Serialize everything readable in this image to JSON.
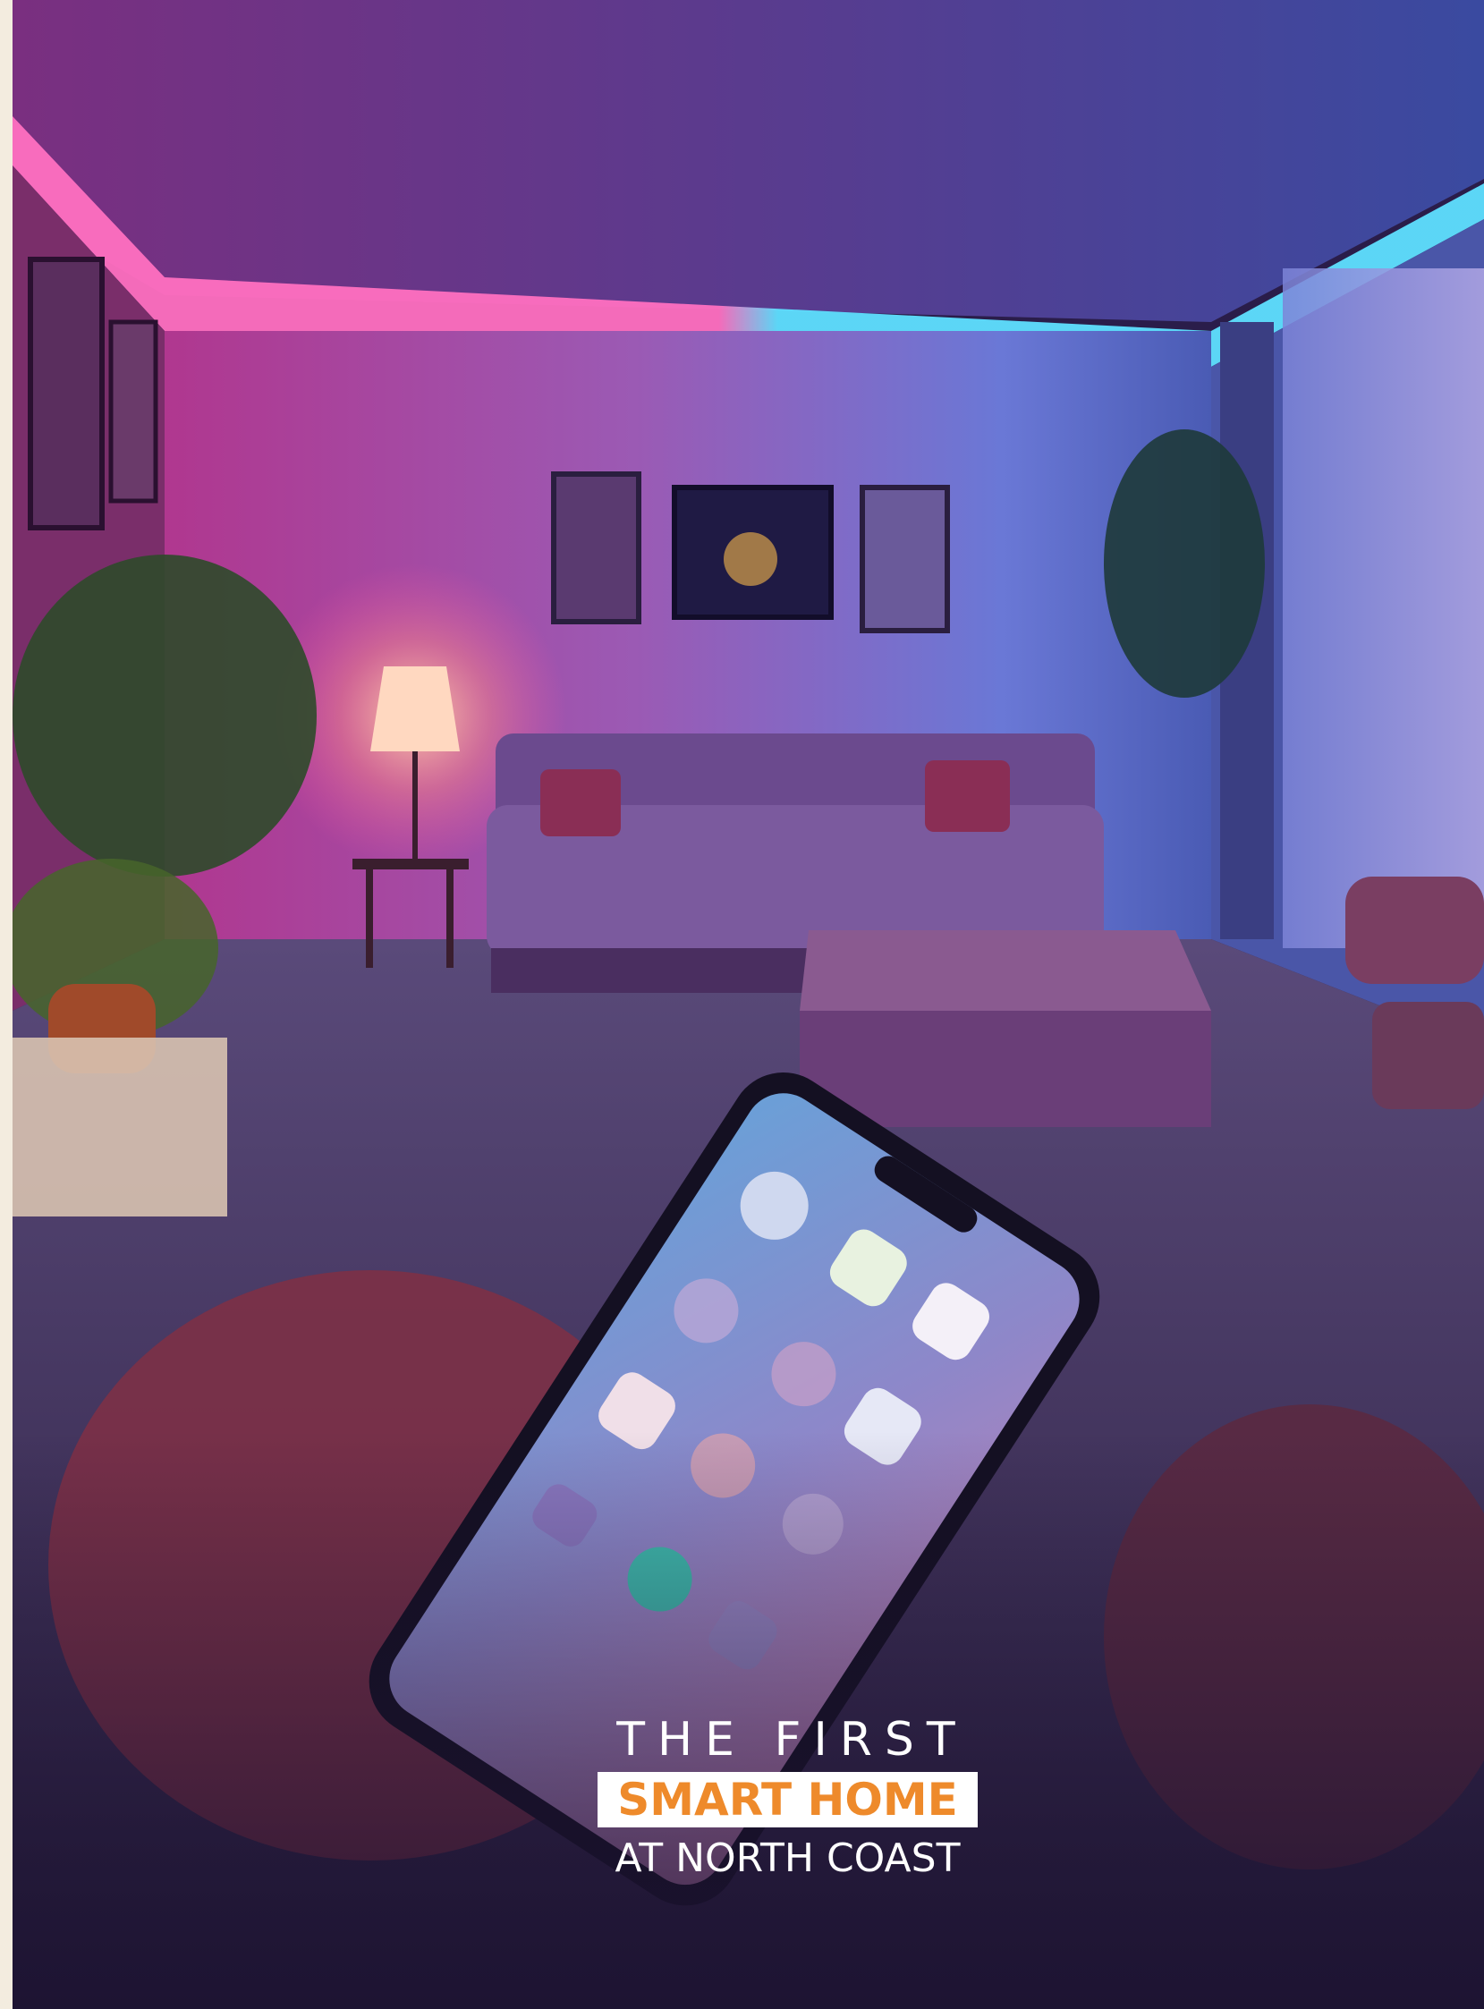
{
  "tagline": {
    "line1": "THE FIRST",
    "line2": "SMART HOME",
    "line3": "AT NORTH COAST"
  },
  "colors": {
    "accent": "#ee8a2b",
    "border": "#f3ecdf",
    "ceiling_pink": "#ff4fa8",
    "ceiling_cyan": "#3fd2ff"
  },
  "icons": [
    "smartphone-icon"
  ]
}
